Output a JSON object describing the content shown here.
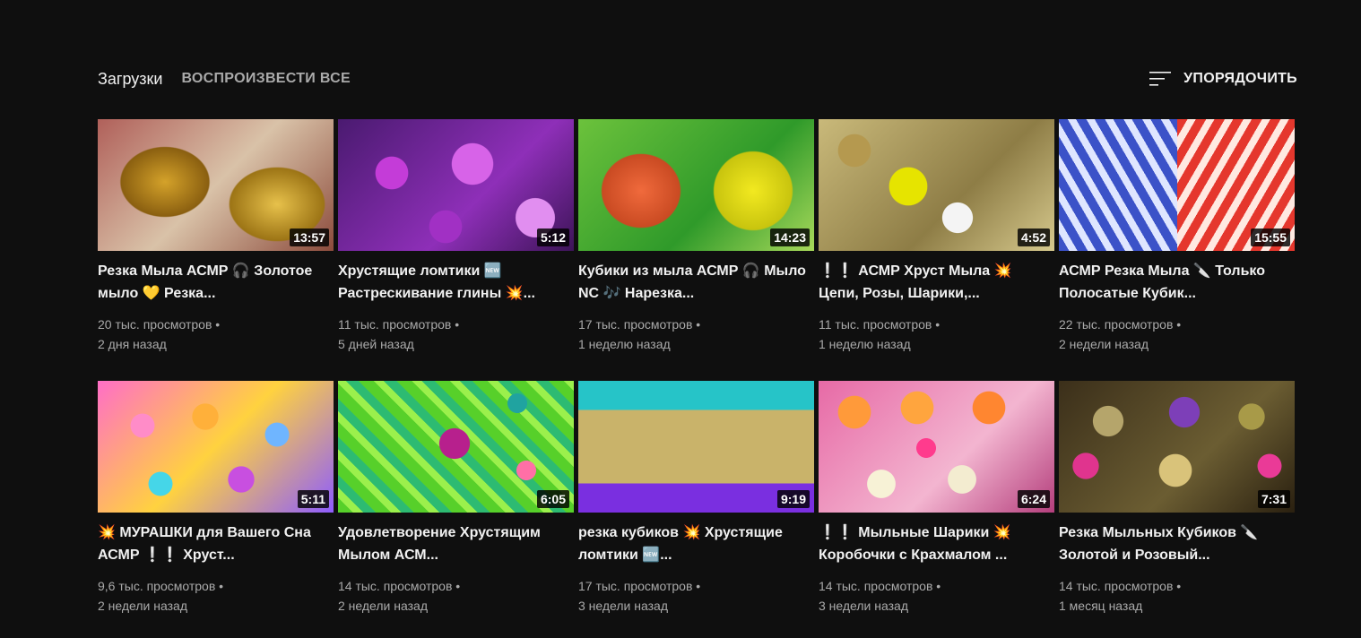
{
  "header": {
    "section_title": "Загрузки",
    "play_all": "ВОСПРОИЗВЕСТИ ВСЕ",
    "sort_label": "УПОРЯДОЧИТЬ",
    "sort_icon": "sort-icon"
  },
  "videos": [
    {
      "title": "Резка Мыла АСМР 🎧 Золотое мыло 💛 Резка...",
      "duration": "13:57",
      "views": "20 тыс. просмотров",
      "age": "2 дня назад"
    },
    {
      "title": "Хрустящие ломтики 🆕 Растрескивание глины 💥...",
      "duration": "5:12",
      "views": "11 тыс. просмотров",
      "age": "5 дней назад"
    },
    {
      "title": "Кубики из мыла АСМР 🎧 Мыло NC 🎶 Нарезка...",
      "duration": "14:23",
      "views": "17 тыс. просмотров",
      "age": "1 неделю назад"
    },
    {
      "title": "❕❕ АСМР Хруст Мыла 💥 Цепи, Розы, Шарики,...",
      "duration": "4:52",
      "views": "11 тыс. просмотров",
      "age": "1 неделю назад"
    },
    {
      "title": "АСМР Резка Мыла 🔪 Только Полосатые Кубик...",
      "duration": "15:55",
      "views": "22 тыс. просмотров",
      "age": "2 недели назад"
    },
    {
      "title": "💥 МУРАШКИ для Вашего Сна АСМР ❕❕ Хруст...",
      "duration": "5:11",
      "views": "9,6 тыс. просмотров",
      "age": "2 недели назад"
    },
    {
      "title": "Удовлетворение Хрустящим Мылом АСМ...",
      "duration": "6:05",
      "views": "14 тыс. просмотров",
      "age": "2 недели назад"
    },
    {
      "title": "резка кубиков 💥 Хрустящие ломтики 🆕...",
      "duration": "9:19",
      "views": "17 тыс. просмотров",
      "age": "3 недели назад"
    },
    {
      "title": "❕❕ Мыльные Шарики 💥 Коробочки с Крахмалом ...",
      "duration": "6:24",
      "views": "14 тыс. просмотров",
      "age": "3 недели назад"
    },
    {
      "title": "Резка Мыльных Кубиков 🔪 Золотой и Розовый...",
      "duration": "7:31",
      "views": "14 тыс. просмотров",
      "age": "1 месяц назад"
    }
  ],
  "meta_separator": " •"
}
